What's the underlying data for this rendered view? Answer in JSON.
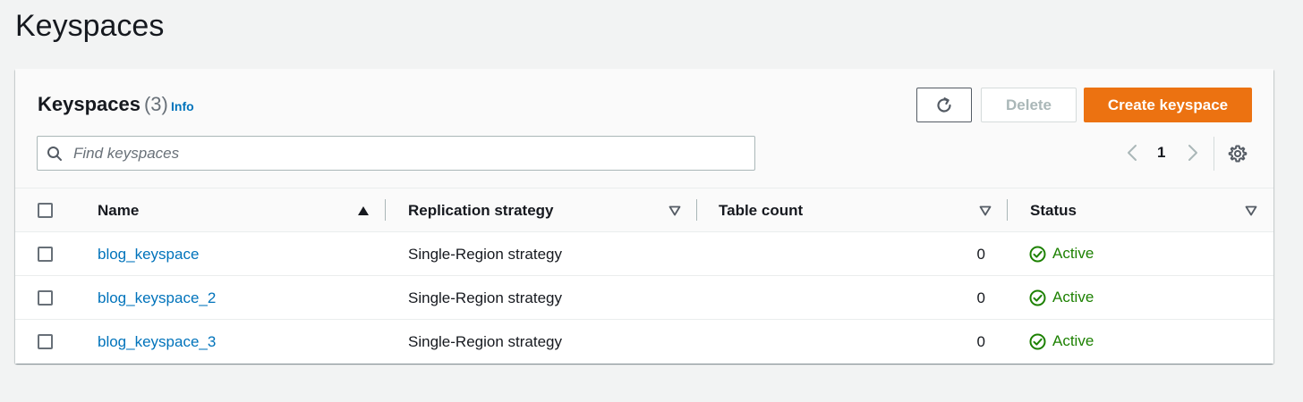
{
  "page": {
    "title": "Keyspaces"
  },
  "panel": {
    "title": "Keyspaces",
    "count": "(3)",
    "info_label": "Info"
  },
  "toolbar": {
    "refresh_icon": "refresh-icon",
    "delete_label": "Delete",
    "create_label": "Create keyspace"
  },
  "search": {
    "placeholder": "Find keyspaces",
    "value": ""
  },
  "pagination": {
    "current_page": "1"
  },
  "table": {
    "columns": [
      {
        "label": "Name",
        "sort": "ascending"
      },
      {
        "label": "Replication strategy",
        "sort": "none"
      },
      {
        "label": "Table count",
        "sort": "none"
      },
      {
        "label": "Status",
        "sort": "none"
      }
    ],
    "rows": [
      {
        "name": "blog_keyspace",
        "replication": "Single-Region strategy",
        "table_count": "0",
        "status": "Active"
      },
      {
        "name": "blog_keyspace_2",
        "replication": "Single-Region strategy",
        "table_count": "0",
        "status": "Active"
      },
      {
        "name": "blog_keyspace_3",
        "replication": "Single-Region strategy",
        "table_count": "0",
        "status": "Active"
      }
    ]
  },
  "colors": {
    "accent": "#ec7211",
    "link": "#0073bb",
    "success": "#1d8102"
  }
}
